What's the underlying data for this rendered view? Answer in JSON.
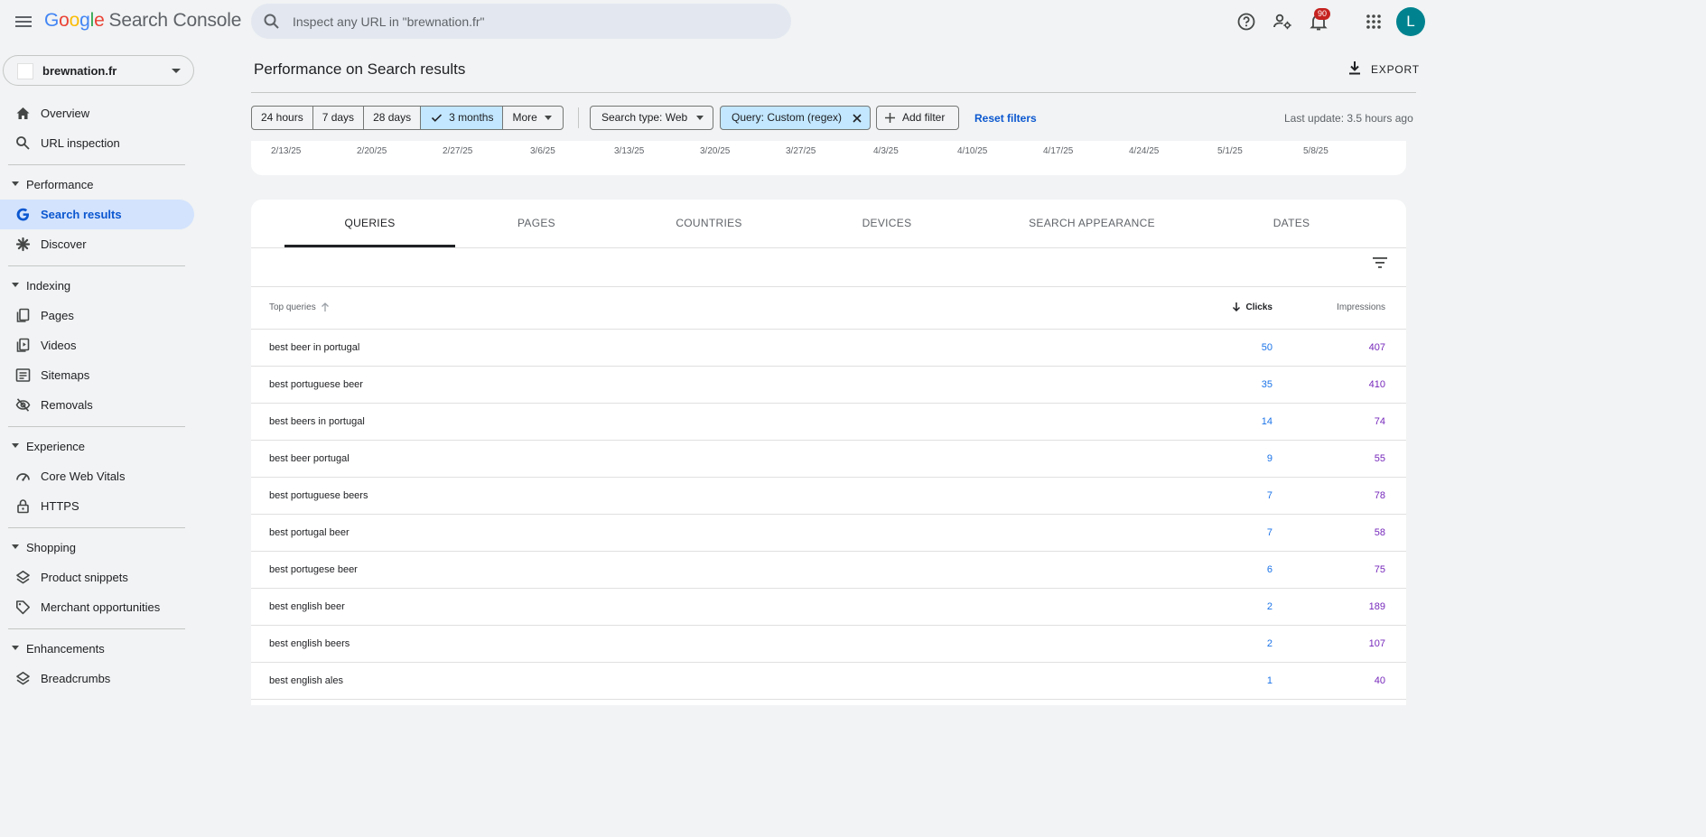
{
  "app": {
    "logo_letters": [
      "G",
      "o",
      "o",
      "g",
      "l",
      "e"
    ],
    "product": "Search Console"
  },
  "search": {
    "placeholder": "Inspect any URL in \"brewnation.fr\""
  },
  "notifications": {
    "count": "90"
  },
  "user": {
    "initial": "L"
  },
  "property": {
    "name": "brewnation.fr"
  },
  "sidebar": {
    "overview": "Overview",
    "url_inspection": "URL inspection",
    "performance": {
      "title": "Performance",
      "search_results": "Search results",
      "discover": "Discover"
    },
    "indexing": {
      "title": "Indexing",
      "pages": "Pages",
      "videos": "Videos",
      "sitemaps": "Sitemaps",
      "removals": "Removals"
    },
    "experience": {
      "title": "Experience",
      "cwv": "Core Web Vitals",
      "https": "HTTPS"
    },
    "shopping": {
      "title": "Shopping",
      "product_snippets": "Product snippets",
      "merchant": "Merchant opportunities"
    },
    "enhancements": {
      "title": "Enhancements",
      "breadcrumbs": "Breadcrumbs"
    }
  },
  "main": {
    "title": "Performance on Search results",
    "export_label": "EXPORT",
    "date_ranges": [
      "24 hours",
      "7 days",
      "28 days",
      "3 months",
      "More"
    ],
    "search_type_chip": "Search type: Web",
    "query_chip": "Query: Custom (regex)",
    "add_filter": "Add filter",
    "reset_filters": "Reset filters",
    "last_update": "Last update: 3.5 hours ago"
  },
  "chart_axis": {
    "x_ticks": [
      "2/13/25",
      "2/20/25",
      "2/27/25",
      "3/6/25",
      "3/13/25",
      "3/20/25",
      "3/27/25",
      "4/3/25",
      "4/10/25",
      "4/17/25",
      "4/24/25",
      "5/1/25",
      "5/8/25"
    ]
  },
  "table": {
    "tabs": [
      "QUERIES",
      "PAGES",
      "COUNTRIES",
      "DEVICES",
      "SEARCH APPEARANCE",
      "DATES"
    ],
    "columns": {
      "query": "Top queries",
      "clicks": "Clicks",
      "impressions": "Impressions"
    },
    "rows": [
      {
        "query": "best beer in portugal",
        "clicks": "50",
        "impressions": "407"
      },
      {
        "query": "best portuguese beer",
        "clicks": "35",
        "impressions": "410"
      },
      {
        "query": "best beers in portugal",
        "clicks": "14",
        "impressions": "74"
      },
      {
        "query": "best beer portugal",
        "clicks": "9",
        "impressions": "55"
      },
      {
        "query": "best portuguese beers",
        "clicks": "7",
        "impressions": "78"
      },
      {
        "query": "best portugal beer",
        "clicks": "7",
        "impressions": "58"
      },
      {
        "query": "best portugese beer",
        "clicks": "6",
        "impressions": "75"
      },
      {
        "query": "best english beer",
        "clicks": "2",
        "impressions": "189"
      },
      {
        "query": "best english beers",
        "clicks": "2",
        "impressions": "107"
      },
      {
        "query": "best english ales",
        "clicks": "1",
        "impressions": "40"
      }
    ]
  }
}
